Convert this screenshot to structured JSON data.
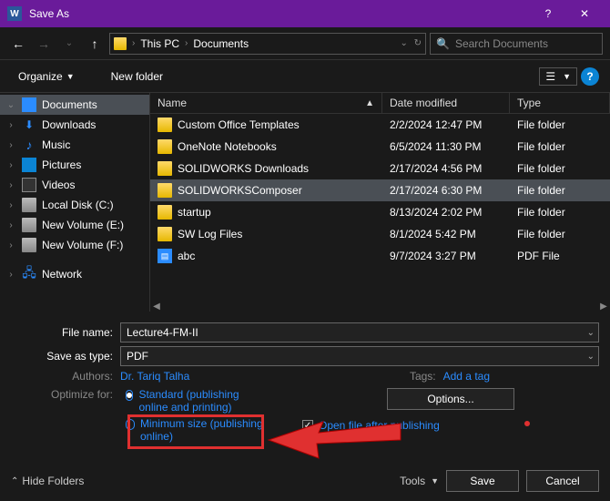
{
  "title": "Save As",
  "addr": {
    "root": "This PC",
    "folder": "Documents"
  },
  "search": {
    "placeholder": "Search Documents"
  },
  "toolbar": {
    "organize": "Organize",
    "newfolder": "New folder"
  },
  "nav": {
    "documents": "Documents",
    "downloads": "Downloads",
    "music": "Music",
    "pictures": "Pictures",
    "videos": "Videos",
    "localdisk": "Local Disk (C:)",
    "newvol_e": "New Volume (E:)",
    "newvol_f": "New Volume (F:)",
    "network": "Network"
  },
  "columns": {
    "name": "Name",
    "date": "Date modified",
    "type": "Type"
  },
  "rows": [
    {
      "name": "Custom Office Templates",
      "date": "2/2/2024 12:47 PM",
      "type": "File folder",
      "kind": "folder"
    },
    {
      "name": "OneNote Notebooks",
      "date": "6/5/2024 11:30 PM",
      "type": "File folder",
      "kind": "folder"
    },
    {
      "name": "SOLIDWORKS Downloads",
      "date": "2/17/2024 4:56 PM",
      "type": "File folder",
      "kind": "folder"
    },
    {
      "name": "SOLIDWORKSComposer",
      "date": "2/17/2024 6:30 PM",
      "type": "File folder",
      "kind": "folder",
      "selected": true
    },
    {
      "name": "startup",
      "date": "8/13/2024 2:02 PM",
      "type": "File folder",
      "kind": "folder"
    },
    {
      "name": "SW Log Files",
      "date": "8/1/2024 5:42 PM",
      "type": "File folder",
      "kind": "folder"
    },
    {
      "name": "abc",
      "date": "9/7/2024 3:27 PM",
      "type": "PDF File",
      "kind": "pdf"
    }
  ],
  "filename": {
    "label": "File name:",
    "value": "Lecture4-FM-II"
  },
  "savetype": {
    "label": "Save as type:",
    "value": "PDF"
  },
  "authors": {
    "label": "Authors:",
    "value": "Dr. Tariq Talha"
  },
  "tags": {
    "label": "Tags:",
    "value": "Add a tag"
  },
  "optimize": {
    "label": "Optimize for:",
    "standard": "Standard (publishing online and printing)",
    "minimum": "Minimum size (publishing online)"
  },
  "options_btn": "Options...",
  "openafter": "Open file after publishing",
  "hidefolders": "Hide Folders",
  "tools": "Tools",
  "save": "Save",
  "cancel": "Cancel"
}
